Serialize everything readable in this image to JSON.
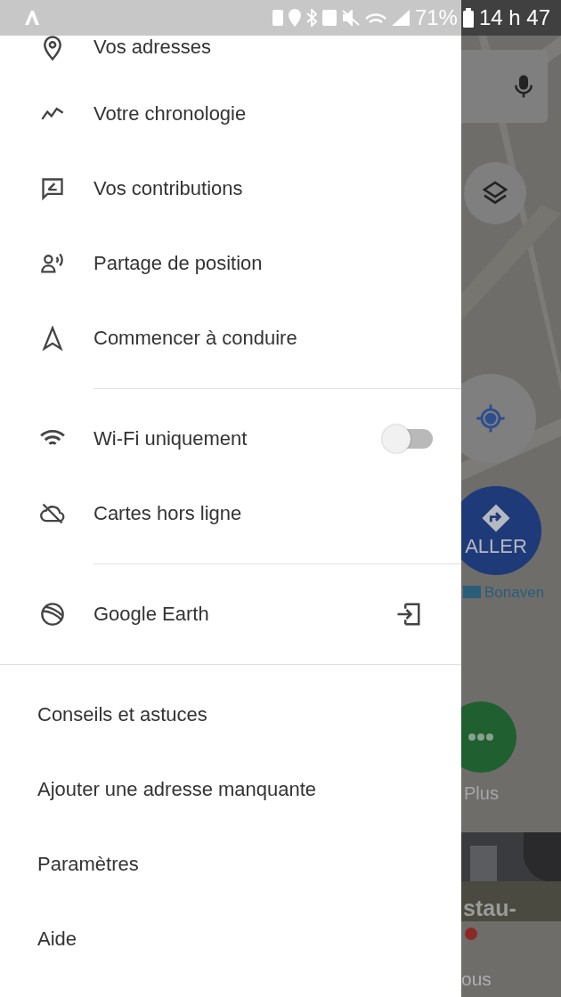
{
  "status_bar": {
    "battery": "71%",
    "time": "14 h 47"
  },
  "menu": {
    "groups": [
      [
        {
          "label": "Vos adresses",
          "kind": "link"
        },
        {
          "label": "Votre chronologie",
          "kind": "link"
        },
        {
          "label": "Vos contributions",
          "kind": "link"
        },
        {
          "label": "Partage de position",
          "kind": "link"
        },
        {
          "label": "Commencer à conduire",
          "kind": "link"
        }
      ],
      [
        {
          "label": "Wi-Fi uniquement",
          "kind": "toggle",
          "on": false
        },
        {
          "label": "Cartes hors ligne",
          "kind": "link"
        }
      ],
      [
        {
          "label": "Google Earth",
          "kind": "external"
        }
      ]
    ],
    "secondary": [
      "Conseils et astuces",
      "Ajouter une adresse manquante",
      "Paramètres",
      "Aide"
    ]
  },
  "map": {
    "go_button": "ALLER",
    "station": "Bonaven",
    "more_button": "Plus",
    "photo_caption": "stau-",
    "card_text": "ous"
  }
}
